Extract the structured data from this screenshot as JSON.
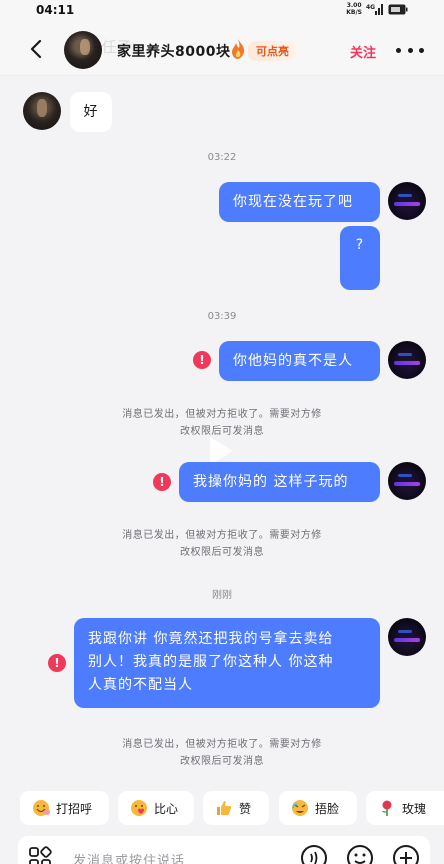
{
  "status": {
    "time": "04:11",
    "net_speed": "3.00",
    "net_unit": "KB/S",
    "signal": "4G"
  },
  "header": {
    "ghost_text": "9任子",
    "title": "家里养头8000块",
    "highlight_tag": "可点亮",
    "follow_label": "关注"
  },
  "messages": {
    "in_1": "好",
    "time_1": "03:22",
    "out_1": "你现在没在玩了吧",
    "out_2": "?",
    "time_2": "03:39",
    "out_3": "你他妈的真不是人",
    "reject_1a": "消息已发出，但被对方拒收了。需要对方修",
    "reject_1b": "改权限后可发消息",
    "out_4": "我操你妈的 这样子玩的",
    "reject_2a": "消息已发出，但被对方拒收了。需要对方修",
    "reject_2b": "改权限后可发消息",
    "time_3": "刚刚",
    "out_5_line1": "我跟你讲 你竟然还把我的号拿去卖给",
    "out_5_line2": "别人！我真的是服了你这种人 你这种",
    "out_5_line3": "人真的不配当人",
    "reject_3a": "消息已发出，但被对方拒收了。需要对方修",
    "reject_3b": "改权限后可发消息",
    "error_mark": "!"
  },
  "quick_replies": [
    {
      "label": "打招呼",
      "icon": "wave-emoji"
    },
    {
      "label": "比心",
      "icon": "heart-hands-emoji"
    },
    {
      "label": "赞",
      "icon": "thumbs-up-emoji"
    },
    {
      "label": "捂脸",
      "icon": "facepalm-emoji"
    },
    {
      "label": "玫瑰",
      "icon": "rose-emoji"
    }
  ],
  "input": {
    "placeholder": "发消息或按住说话"
  },
  "colors": {
    "outgoing_bubble": "#4d7cfe",
    "accent_red": "#f0385a",
    "tag_orange": "#e45a1e"
  }
}
